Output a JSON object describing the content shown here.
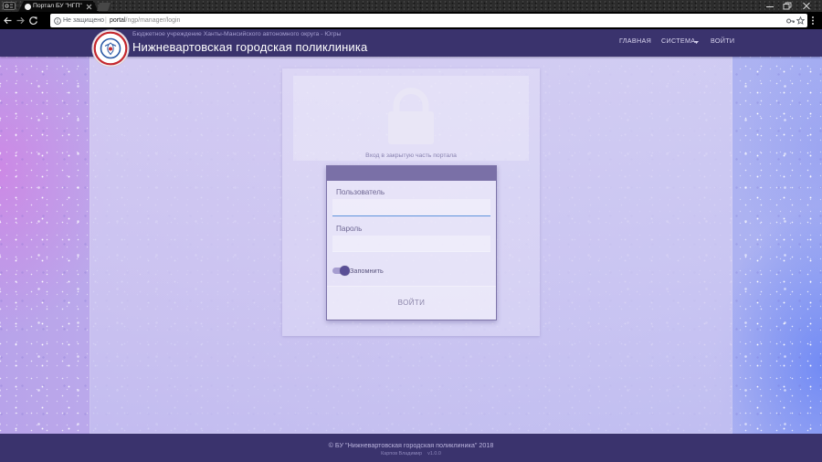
{
  "browser": {
    "tab": {
      "title": "Портал БУ \"НГП\"",
      "favicon": "page-favicon-icon",
      "close_icon": "close-icon"
    },
    "new_tab_icon": "new-tab-icon",
    "window_controls": {
      "minimize": "minimize-icon",
      "restore": "restore-icon",
      "close": "close-icon"
    },
    "toolbar": {
      "back": "back-arrow-icon",
      "forward": "forward-arrow-icon",
      "reload": "reload-icon",
      "menu": "more-vert-icon"
    },
    "omnibox": {
      "security_icon": "info-icon",
      "security_label": "Не защищено",
      "separator": "|",
      "url_host": "portal",
      "url_path": "/ngp/manager/login",
      "key_icon": "key-icon",
      "bookmark_icon": "star-icon"
    }
  },
  "header": {
    "logo_icon": "clinic-emblem-icon",
    "subtitle": "Бюджетное учреждение Ханты-Мансийского автономного округа - Югры",
    "title": "Нижневартовская городская поликлиника",
    "nav": [
      {
        "label": "ГЛАВНАЯ"
      },
      {
        "label": "СИСТЕМА",
        "dropdown": true,
        "icon": "caret-down-icon"
      },
      {
        "label": "ВОЙТИ"
      }
    ]
  },
  "lock_panel": {
    "icon": "padlock-icon",
    "caption": "Вход в закрытую часть портала"
  },
  "login_form": {
    "username": {
      "label": "Пользователь",
      "value": ""
    },
    "password": {
      "label": "Пароль",
      "value": ""
    },
    "remember": {
      "label": "Запомнить",
      "checked": true
    },
    "submit_label": "ВОЙТИ"
  },
  "footer": {
    "copyright": "© БУ \"Нижневартовская городская поликлиника\" 2018",
    "author": "Карпов Владимир",
    "version": "v1.0.0"
  },
  "theme": {
    "header_bg": "#3a336d",
    "footer_bg": "#3a336d",
    "form_header_bg": "#7a70a7",
    "input_focus_color": "#5e93dc",
    "toggle_on_color": "#5a4f96",
    "logo_ring_color": "#c4282e"
  }
}
